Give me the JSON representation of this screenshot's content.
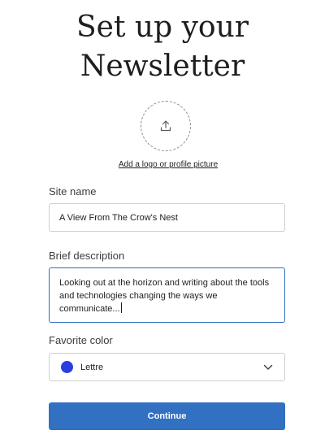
{
  "page": {
    "title_line1": "Set up your",
    "title_line2": "Newsletter"
  },
  "upload": {
    "icon": "upload-icon",
    "link_label": "Add a logo or profile picture"
  },
  "site_name": {
    "label": "Site name",
    "value": "A View From The Crow's Nest"
  },
  "description": {
    "label": "Brief description",
    "value": "Looking out at the horizon and writing about the tools and technologies changing the ways we communicate..."
  },
  "favorite_color": {
    "label": "Favorite color",
    "selected": "Lettre",
    "swatch_color": "#2a3fe0",
    "icon": "chevron-down-icon"
  },
  "actions": {
    "continue_label": "Continue",
    "accent_color": "#3270c2"
  }
}
